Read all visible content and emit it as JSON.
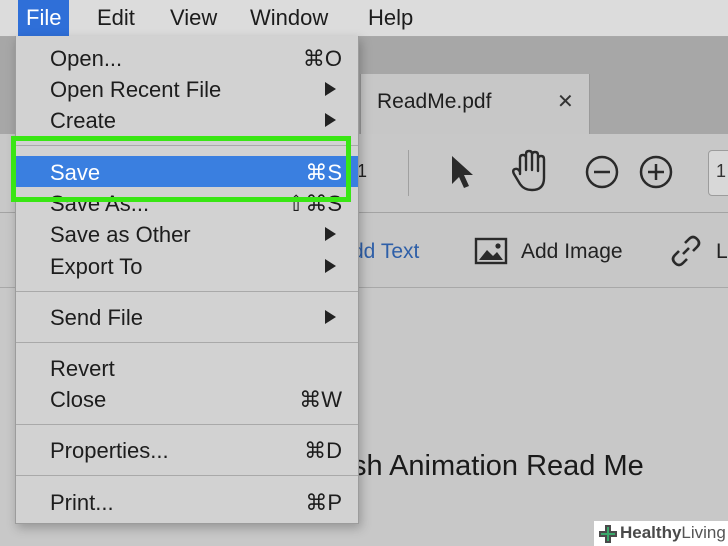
{
  "menubar": {
    "items": [
      "File",
      "Edit",
      "View",
      "Window",
      "Help"
    ]
  },
  "document": {
    "tab_title": "ReadMe.pdf",
    "tab_close": "✕",
    "page_indicator_partial": "1",
    "page_number_partial": "1",
    "add_text_label": "dd Text",
    "add_image_label": "Add Image",
    "link_label_partial": "L",
    "heading_partial": "sh Animation Read Me"
  },
  "file_menu": {
    "open": {
      "label": "Open...",
      "shortcut": "⌘O"
    },
    "open_recent": {
      "label": "Open Recent File"
    },
    "create": {
      "label": "Create"
    },
    "save": {
      "label": "Save",
      "shortcut": "⌘S"
    },
    "save_as": {
      "label": "Save As...",
      "shortcut": "⇧⌘S"
    },
    "save_as_other": {
      "label": "Save as Other"
    },
    "export_to": {
      "label": "Export To"
    },
    "send_file": {
      "label": "Send File"
    },
    "revert": {
      "label": "Revert"
    },
    "close": {
      "label": "Close",
      "shortcut": "⌘W"
    },
    "properties": {
      "label": "Properties...",
      "shortcut": "⌘D"
    },
    "print": {
      "label": "Print...",
      "shortcut": "⌘P"
    }
  },
  "watermark": {
    "text_bold": "Healthy",
    "text_light": "Living"
  },
  "colors": {
    "menu_highlight": "#3a7fe0",
    "callout": "#39e614"
  }
}
